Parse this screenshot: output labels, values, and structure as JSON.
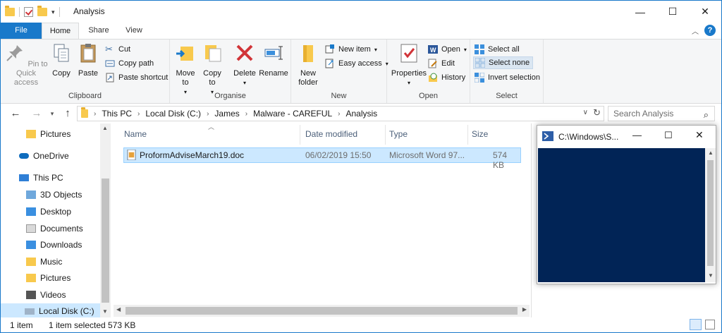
{
  "window": {
    "title": "Analysis"
  },
  "title_controls": {
    "minimize": "—",
    "maximize": "☐",
    "close": "✕"
  },
  "ribbon_tabs": [
    "File",
    "Home",
    "Share",
    "View"
  ],
  "ribbon": {
    "clipboard": {
      "label": "Clipboard",
      "pin": "Pin to Quick access",
      "copy": "Copy",
      "paste": "Paste",
      "cut": "Cut",
      "copy_path": "Copy path",
      "paste_shortcut": "Paste shortcut"
    },
    "organise": {
      "label": "Organise",
      "move_to": "Move to",
      "copy_to": "Copy to",
      "delete": "Delete",
      "rename": "Rename"
    },
    "new": {
      "label": "New",
      "new_folder": "New folder",
      "new_item": "New item",
      "easy_access": "Easy access"
    },
    "open": {
      "label": "Open",
      "properties": "Properties",
      "open": "Open",
      "edit": "Edit",
      "history": "History"
    },
    "select": {
      "label": "Select",
      "select_all": "Select all",
      "select_none": "Select none",
      "invert_selection": "Invert selection"
    }
  },
  "address": {
    "crumbs": [
      "This PC",
      "Local Disk (C:)",
      "James",
      "Malware - CAREFUL",
      "Analysis"
    ],
    "search_placeholder": "Search Analysis"
  },
  "nav_pane": {
    "items": [
      {
        "label": "Pictures",
        "icon": "pictures-folder-icon"
      },
      {
        "label": "OneDrive",
        "icon": "onedrive-icon"
      },
      {
        "label": "This PC",
        "icon": "computer-icon"
      },
      {
        "label": "3D Objects",
        "icon": "3d-objects-icon"
      },
      {
        "label": "Desktop",
        "icon": "desktop-folder-icon"
      },
      {
        "label": "Documents",
        "icon": "documents-folder-icon"
      },
      {
        "label": "Downloads",
        "icon": "downloads-folder-icon"
      },
      {
        "label": "Music",
        "icon": "music-folder-icon"
      },
      {
        "label": "Pictures",
        "icon": "pictures-folder-icon"
      },
      {
        "label": "Videos",
        "icon": "videos-folder-icon"
      },
      {
        "label": "Local Disk (C:)",
        "icon": "drive-icon"
      }
    ]
  },
  "file_list": {
    "columns": {
      "name": "Name",
      "date": "Date modified",
      "type": "Type",
      "size": "Size"
    },
    "rows": [
      {
        "name": "ProformAdviseMarch19.doc",
        "date": "06/02/2019 15:50",
        "type": "Microsoft Word 97...",
        "size": "574 KB"
      }
    ]
  },
  "console": {
    "title": "C:\\Windows\\S..."
  },
  "status": {
    "count": "1 item",
    "selected": "1 item selected  573 KB"
  },
  "colors": {
    "accent": "#1979ca",
    "selection": "#cce8ff",
    "console_bg": "#012456"
  }
}
